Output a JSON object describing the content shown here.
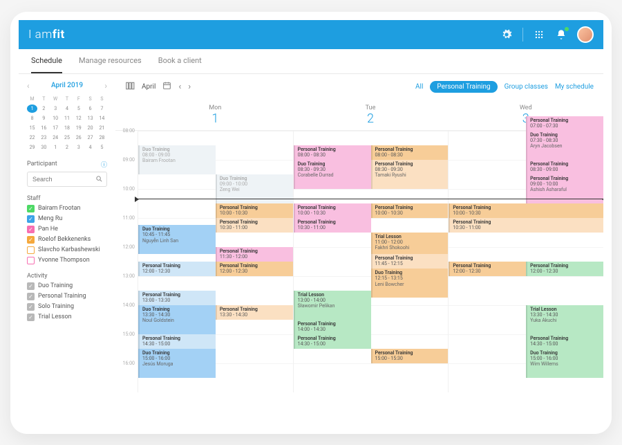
{
  "brand": {
    "prefix": "I am",
    "suffix": "fit"
  },
  "tabs": [
    "Schedule",
    "Manage resources",
    "Book a client"
  ],
  "active_tab": 0,
  "minical": {
    "title": "April 2019",
    "dows": [
      "M",
      "T",
      "W",
      "T",
      "F",
      "S",
      "S"
    ],
    "weeks": [
      [
        1,
        2,
        3,
        4,
        5,
        6,
        7
      ],
      [
        8,
        9,
        10,
        11,
        12,
        13,
        14
      ],
      [
        15,
        16,
        17,
        18,
        19,
        20,
        21
      ],
      [
        22,
        23,
        24,
        25,
        26,
        27,
        28
      ],
      [
        29,
        30,
        1,
        2,
        3,
        4,
        5
      ]
    ],
    "today": 1
  },
  "participant": {
    "label": "Participant",
    "search_placeholder": "Search"
  },
  "staff": {
    "label": "Staff",
    "items": [
      {
        "name": "Bairam Frootan",
        "color": "green",
        "checked": true
      },
      {
        "name": "Meng Ru",
        "color": "blue",
        "checked": true
      },
      {
        "name": "Pan He",
        "color": "pink",
        "checked": true
      },
      {
        "name": "Roelof Bekkenenks",
        "color": "orange",
        "checked": true
      },
      {
        "name": "Slavcho Karbashewski",
        "color": "empty-orange",
        "checked": false
      },
      {
        "name": "Yvonne Thompson",
        "color": "empty-pink",
        "checked": false
      }
    ]
  },
  "activity": {
    "label": "Activity",
    "items": [
      {
        "name": "Duo Training",
        "checked": true
      },
      {
        "name": "Personal Training",
        "checked": true
      },
      {
        "name": "Solo Training",
        "checked": true
      },
      {
        "name": "Trial Lesson",
        "checked": true
      }
    ]
  },
  "toolbar": {
    "month": "April",
    "filters": [
      "All",
      "Personal Training",
      "Group classes",
      "My schedule"
    ],
    "active_filter": 1
  },
  "days": [
    {
      "dow": "Mon",
      "num": "1"
    },
    {
      "dow": "Tue",
      "num": "2"
    },
    {
      "dow": "Wed",
      "num": "3"
    }
  ],
  "hours": [
    "08:00",
    "09:00",
    "10:00",
    "11:00",
    "12:00",
    "13:00",
    "14:00",
    "15:00",
    "16:00"
  ],
  "hour_height": 42,
  "start_hour": 7.5,
  "now": 9.85,
  "events": {
    "mon": [
      {
        "t": "Duo Training",
        "s": 8.0,
        "e": 9.0,
        "tm": "08:00 - 09:00",
        "p": "Bairam Frootan",
        "c": "c-faint",
        "col": "half"
      },
      {
        "t": "Duo Training",
        "s": 9.0,
        "e": 10.0,
        "tm": "09:00 - 10:00",
        "p": "Zeng Wei",
        "c": "c-faint",
        "col": "half2"
      },
      {
        "t": "Personal Training",
        "s": 10.0,
        "e": 10.5,
        "tm": "10:00 - 10:30",
        "c": "c-orange",
        "col": "half2"
      },
      {
        "t": "Personal Training",
        "s": 10.5,
        "e": 11.0,
        "tm": "10:30 - 11:00",
        "c": "c-peach",
        "col": "half2"
      },
      {
        "t": "Duo Training",
        "s": 10.75,
        "e": 11.75,
        "tm": "10:45 - 11:45",
        "p": "Nguyễn Linh San",
        "c": "c-blue",
        "col": "half"
      },
      {
        "t": "Personal Training",
        "s": 11.5,
        "e": 12.0,
        "tm": "11:30 - 12:00",
        "c": "c-pink",
        "col": "half2"
      },
      {
        "t": "Personal Training",
        "s": 12.0,
        "e": 12.5,
        "tm": "12:00 - 12:30",
        "c": "c-lblue",
        "col": "half"
      },
      {
        "t": "Personal Training",
        "s": 12.0,
        "e": 12.5,
        "tm": "12:00 - 12:30",
        "c": "c-orange",
        "col": "half2"
      },
      {
        "t": "Personal Training",
        "s": 13.0,
        "e": 13.5,
        "tm": "13:00 - 13:30",
        "c": "c-lblue",
        "col": "half"
      },
      {
        "t": "Personal Training",
        "s": 13.5,
        "e": 14.0,
        "tm": "13:30 - 14:30",
        "c": "c-peach",
        "col": "half2"
      },
      {
        "t": "Duo Training",
        "s": 13.5,
        "e": 14.5,
        "tm": "13:30 - 14:30",
        "p": "Noul Goldstein",
        "c": "c-blue",
        "col": "half"
      },
      {
        "t": "Personal Training",
        "s": 14.5,
        "e": 15.0,
        "tm": "14:30 - 15:00",
        "c": "c-lblue",
        "col": "half"
      },
      {
        "t": "Duo Training",
        "s": 15.0,
        "e": 16.0,
        "tm": "15:00 - 16:00",
        "p": "Jesús Moruga",
        "c": "c-blue",
        "col": "half"
      }
    ],
    "tue": [
      {
        "t": "Personal Training",
        "s": 8.0,
        "e": 8.5,
        "tm": "08:00 - 08:30",
        "c": "c-pink"
      },
      {
        "t": "Duo Training",
        "s": 8.5,
        "e": 9.5,
        "tm": "08:30 - 09:30",
        "p": "Corabelle Durrad",
        "c": "c-pink"
      },
      {
        "t": "Personal Training",
        "s": 8.0,
        "e": 8.5,
        "tm": "08:00 - 08:30",
        "c": "c-orange",
        "col": "half2",
        "day": 1
      },
      {
        "t": "Personal Training",
        "s": 8.5,
        "e": 9.5,
        "tm": "08:30 - 09:30",
        "p": "Tamaki Ryushi",
        "c": "c-peach",
        "col": "half2",
        "day": 1
      },
      {
        "t": "Personal Training",
        "s": 10.0,
        "e": 10.5,
        "tm": "10:00 - 10:30",
        "c": "c-pink",
        "col": "half"
      },
      {
        "t": "Personal Training",
        "s": 10.5,
        "e": 11.0,
        "tm": "10:30 - 11:00",
        "c": "c-pink",
        "col": "half"
      },
      {
        "t": "Personal Training",
        "s": 10.0,
        "e": 10.5,
        "tm": "10:00 - 10:30",
        "c": "c-orange",
        "col": "half2"
      },
      {
        "t": "Trial Lesson",
        "s": 11.0,
        "e": 12.0,
        "tm": "11:00 - 12:00",
        "p": "Fakhri Shokoohi",
        "c": "c-orange",
        "col": "half2"
      },
      {
        "t": "Personal Training",
        "s": 11.75,
        "e": 12.25,
        "tm": "11:45 - 12:15",
        "c": "c-peach",
        "col": "half2"
      },
      {
        "t": "Duo Training",
        "s": 12.25,
        "e": 13.25,
        "tm": "12:15 - 13:15",
        "p": "Leni Bowcher",
        "c": "c-orange",
        "col": "half2"
      },
      {
        "t": "Trial Lesson",
        "s": 13.0,
        "e": 14.0,
        "tm": "13:00 - 14:00",
        "p": "Sławomir Pelikan",
        "c": "c-green",
        "col": "half"
      },
      {
        "t": "Personal Training",
        "s": 14.0,
        "e": 14.5,
        "tm": "14:00 - 14:30",
        "c": "c-green",
        "col": "half"
      },
      {
        "t": "Personal Training",
        "s": 14.5,
        "e": 15.0,
        "tm": "14:30 - 15:00",
        "c": "c-green",
        "col": "half"
      },
      {
        "t": "Personal Training",
        "s": 15.0,
        "e": 15.5,
        "tm": "15:00 - 15:30",
        "c": "c-orange",
        "col": "half2"
      }
    ],
    "wed": [
      {
        "t": "Personal Training",
        "s": 7.0,
        "e": 7.5,
        "tm": "07:00 - 07:30",
        "c": "c-pink",
        "col": "half2"
      },
      {
        "t": "Duo Training",
        "s": 7.5,
        "e": 8.5,
        "tm": "07:30 - 08:30",
        "p": "Aryn Jacobsen",
        "c": "c-pink",
        "col": "half2"
      },
      {
        "t": "Personal Training",
        "s": 8.5,
        "e": 9.0,
        "tm": "08:30 - 09:00",
        "c": "c-pink",
        "col": "half2"
      },
      {
        "t": "Personal Training",
        "s": 9.0,
        "e": 10.0,
        "tm": "09:00 - 10:00",
        "p": "Ashish Asharaful",
        "c": "c-pink",
        "col": "half2"
      },
      {
        "t": "Personal Training",
        "s": 10.0,
        "e": 10.5,
        "tm": "10:00 - 10:30",
        "c": "c-orange"
      },
      {
        "t": "Personal Training",
        "s": 10.5,
        "e": 11.0,
        "tm": "10:30 - 11:00",
        "c": "c-peach"
      },
      {
        "t": "Personal Training",
        "s": 12.0,
        "e": 12.5,
        "tm": "12:00 - 12:30",
        "c": "c-orange",
        "col": "half"
      },
      {
        "t": "Personal Training",
        "s": 12.0,
        "e": 12.5,
        "tm": "12:00 - 12:30",
        "c": "c-green",
        "col": "half2"
      },
      {
        "t": "Trial Lesson",
        "s": 13.5,
        "e": 14.5,
        "tm": "13:30 - 14:30",
        "p": "Yuka Akuchi",
        "c": "c-green",
        "col": "half2"
      },
      {
        "t": "Personal Training",
        "s": 14.5,
        "e": 15.0,
        "tm": "14:30 - 15:00",
        "c": "c-green",
        "col": "half2"
      },
      {
        "t": "Duo Training",
        "s": 15.0,
        "e": 16.0,
        "tm": "15:00 - 16:00",
        "p": "Wim Willems",
        "c": "c-green",
        "col": "half2"
      }
    ]
  }
}
